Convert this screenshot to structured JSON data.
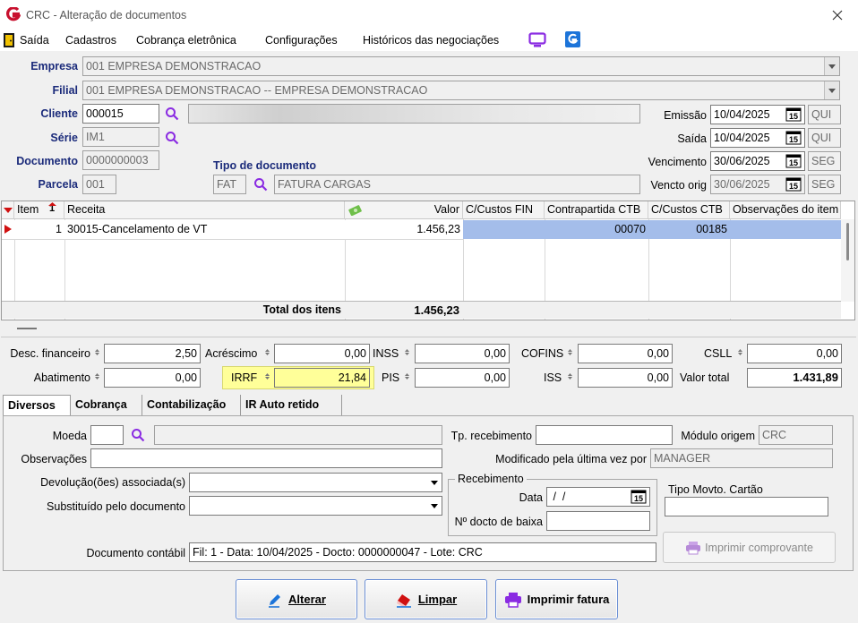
{
  "window": {
    "title": "CRC - Alteração de documentos"
  },
  "menu": [
    "Saída",
    "Cadastros",
    "Cobrança eletrônica",
    "Configurações",
    "Históricos das negociações"
  ],
  "header": {
    "empresa": {
      "label": "Empresa",
      "value": "001 EMPRESA DEMONSTRACAO"
    },
    "filial": {
      "label": "Filial",
      "value": "001 EMPRESA DEMONSTRACAO -- EMPRESA DEMONSTRACAO"
    },
    "cliente": {
      "label": "Cliente",
      "value": "000015"
    },
    "serie": {
      "label": "Série",
      "value": "IM1"
    },
    "documento": {
      "label": "Documento",
      "value": "0000000003"
    },
    "parcela": {
      "label": "Parcela",
      "value": "001"
    },
    "tipo": {
      "label": "Tipo de documento",
      "code": "FAT",
      "desc": "FATURA CARGAS"
    },
    "emissao": {
      "label": "Emissão",
      "date": "10/04/2025",
      "day": "QUI"
    },
    "saida": {
      "label": "Saída",
      "date": "10/04/2025",
      "day": "QUI"
    },
    "vencimento": {
      "label": "Vencimento",
      "date": "30/06/2025",
      "day": "SEG"
    },
    "vencto_orig": {
      "label": "Vencto orig",
      "date": "30/06/2025",
      "day": "SEG"
    }
  },
  "grid": {
    "sort_digit": "1",
    "columns": [
      "Item",
      "Receita",
      "Valor",
      "C/Custos FIN",
      "Contrapartida CTB",
      "C/Custos CTB",
      "Observações do item"
    ],
    "row": {
      "item": "1",
      "receita": "30015-Cancelamento de VT",
      "valor": "1.456,23",
      "ccfin": "",
      "contrapartida": "00070",
      "ccctb": "00185",
      "obs": ""
    },
    "total_label": "Total dos itens",
    "total_value": "1.456,23"
  },
  "totals": {
    "desc_fin": {
      "label": "Desc. financeiro",
      "value": "2,50"
    },
    "acrescimo": {
      "label": "Acréscimo",
      "value": "0,00"
    },
    "inss": {
      "label": "INSS",
      "value": "0,00"
    },
    "cofins": {
      "label": "COFINS",
      "value": "0,00"
    },
    "csll": {
      "label": "CSLL",
      "value": "0,00"
    },
    "abatimento": {
      "label": "Abatimento",
      "value": "0,00"
    },
    "irrf": {
      "label": "IRRF",
      "value": "21,84"
    },
    "pis": {
      "label": "PIS",
      "value": "0,00"
    },
    "iss": {
      "label": "ISS",
      "value": "0,00"
    },
    "valor_total": {
      "label": "Valor total",
      "value": "1.431,89"
    }
  },
  "tabs": [
    "Diversos",
    "Cobrança",
    "Contabilização",
    "IR Auto retido"
  ],
  "diversos": {
    "moeda": {
      "label": "Moeda",
      "value": ""
    },
    "observacoes": {
      "label": "Observações",
      "value": ""
    },
    "devolucao": {
      "label": "Devolução(ões) associada(s)",
      "value": ""
    },
    "substituido": {
      "label": "Substituído pelo documento",
      "value": ""
    },
    "tp_recebimento": {
      "label": "Tp. recebimento",
      "value": ""
    },
    "modulo_origem": {
      "label": "Módulo origem",
      "value": "CRC"
    },
    "modificado": {
      "label": "Modificado pela última vez por",
      "value": "MANAGER"
    },
    "recebimento": {
      "title": "Recebimento",
      "data_label": "Data",
      "data_value": " /  /",
      "docto_label": "Nº docto de baixa",
      "docto_value": ""
    },
    "tipo_movto": {
      "label": "Tipo Movto. Cartão",
      "value": ""
    },
    "imprimir_comprovante": "Imprimir comprovante",
    "doc_contabil": {
      "label": "Documento contábil",
      "value": "Fil: 1 - Data: 10/04/2025 - Docto: 0000000047 - Lote: CRC"
    }
  },
  "buttons": {
    "alterar": "Alterar",
    "limpar": "Limpar",
    "imprimir": "Imprimir fatura"
  },
  "colors": {
    "accent_label": "#1a2a7a",
    "selection": "#a4bdea",
    "irrf_highlight": "#ffff99",
    "brand_red": "#c8102e",
    "brand_blue": "#1c74d9",
    "purple": "#8a2be2"
  }
}
